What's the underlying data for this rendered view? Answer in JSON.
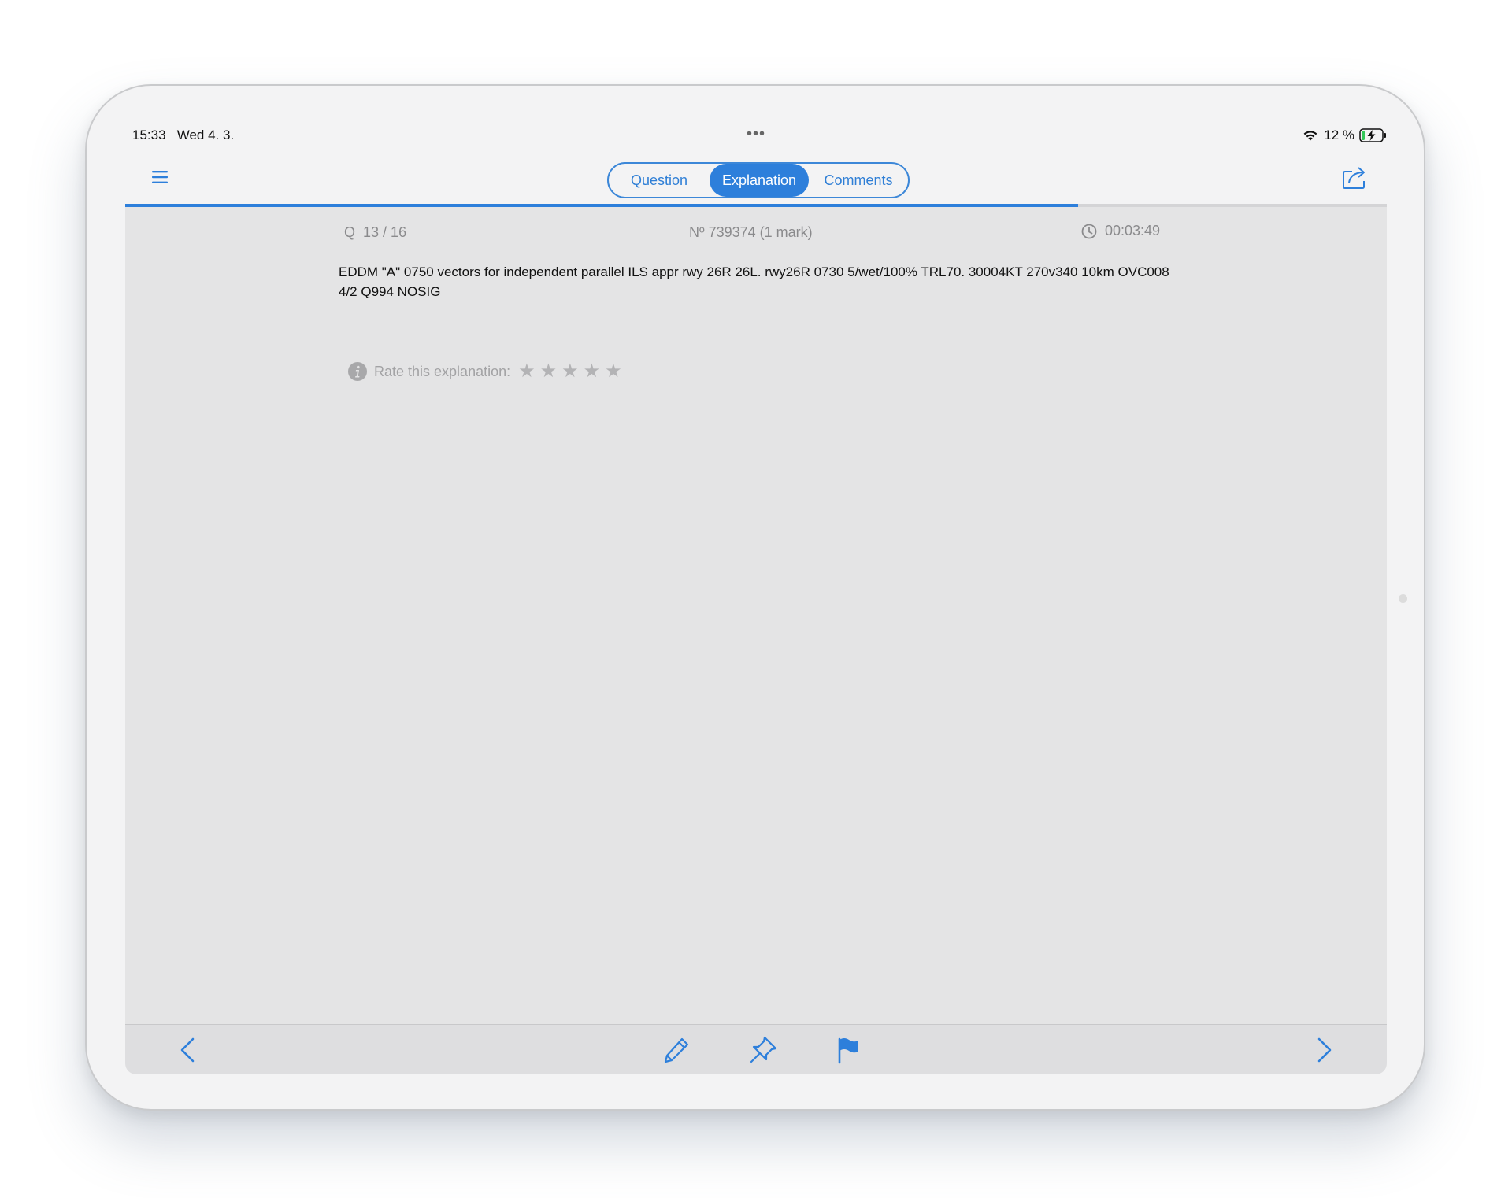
{
  "status_bar": {
    "time": "15:33",
    "date": "Wed 4. 3.",
    "battery_percent": "12 %",
    "icons": [
      "wifi-icon",
      "battery-charging-icon"
    ]
  },
  "nav": {
    "tabs": [
      {
        "label": "Question",
        "selected": false
      },
      {
        "label": "Explanation",
        "selected": true
      },
      {
        "label": "Comments",
        "selected": false
      }
    ],
    "icons": [
      "hamburger-menu-icon",
      "share-icon"
    ],
    "accent_color": "#2d7fdb"
  },
  "progress": {
    "fraction": 0.755
  },
  "meta": {
    "question_prefix": "Q",
    "question_counter": "13 / 16",
    "question_id": "Nº 739374 (1 mark)",
    "timer": "00:03:49"
  },
  "question": {
    "text": "EDDM \"A\" 0750 vectors for independent parallel ILS appr rwy 26R 26L. rwy26R 0730 5/wet/100% TRL70. 30004KT 270v340 10km OVC008 4/2 Q994 NOSIG"
  },
  "rating": {
    "label": "Rate this explanation:",
    "stars_total": 5,
    "stars_selected": 0
  },
  "toolbar": {
    "icons": [
      "previous-arrow-icon",
      "pencil-icon",
      "pin-icon",
      "flag-icon",
      "next-arrow-icon"
    ]
  }
}
